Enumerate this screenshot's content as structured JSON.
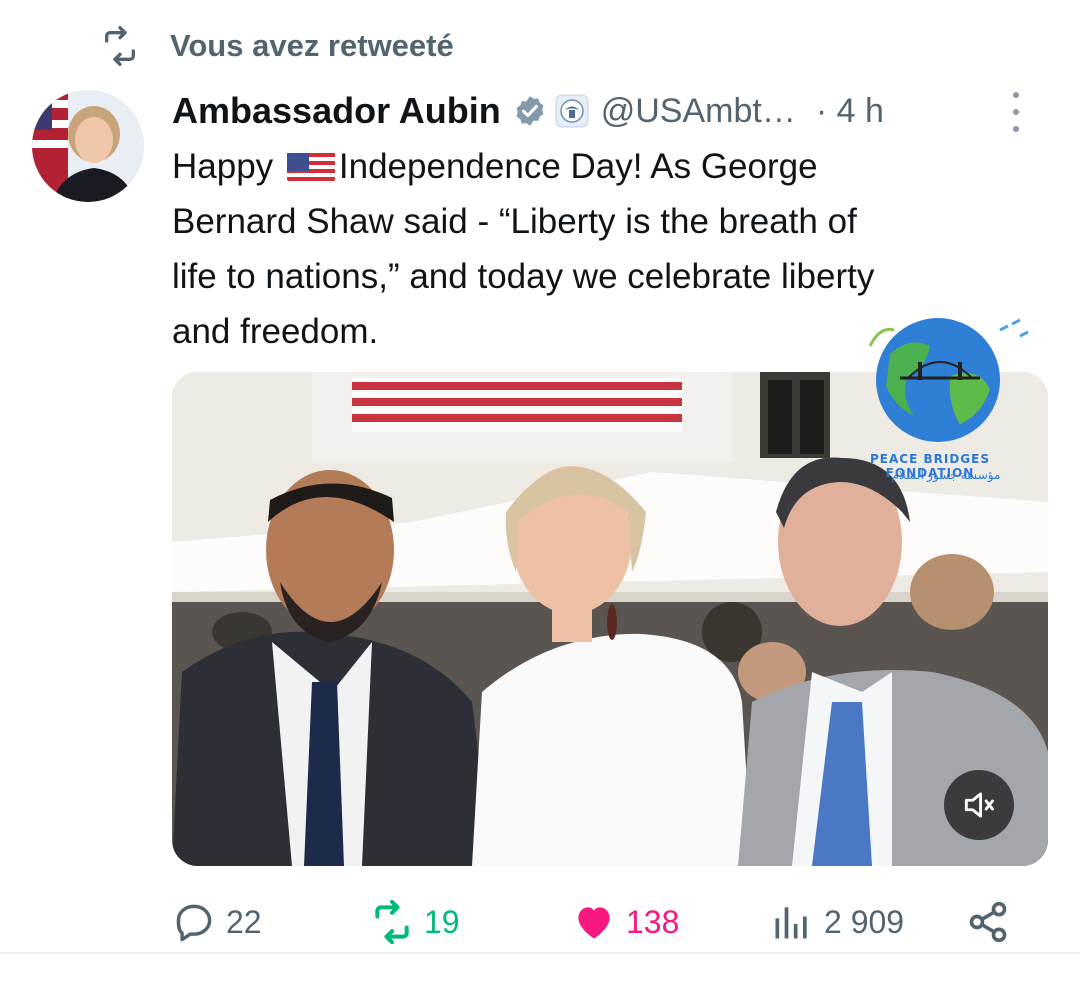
{
  "retweet": {
    "label": "Vous avez retweeté"
  },
  "tweet": {
    "author_name": "Ambassador Aubin",
    "handle": "@USAmbt…",
    "time": "· 4 h",
    "text_lines": [
      [
        "Happy ",
        " Independence Day!  As George"
      ],
      "Bernard Shaw said - “Liberty is the breath of",
      "life to nations,” and today we celebrate liberty",
      "and freedom."
    ],
    "line1_before": "Happy",
    "line1_after": "Independence Day!  As George",
    "line2": "Bernard Shaw said - “Liberty is the breath of",
    "line3": "life to nations,” and today we celebrate liberty",
    "line4": "and freedom."
  },
  "media": {
    "watermark_en": "PEACE BRIDGES FONDATION",
    "watermark_ar": "مؤسسة جسور السلام"
  },
  "actions": {
    "replies": "22",
    "retweets": "19",
    "likes": "138",
    "views": "2 909"
  },
  "colors": {
    "retweet_green": "#00ba7c",
    "like_pink": "#f91880",
    "muted_gray": "#536471",
    "verified_blue": "#1d9bf0"
  },
  "icons": [
    "retweet-icon",
    "verified-badge-icon",
    "government-seal-icon",
    "more-icon",
    "flag-us-icon",
    "mute-icon",
    "reply-icon",
    "like-icon",
    "views-icon",
    "share-icon"
  ]
}
